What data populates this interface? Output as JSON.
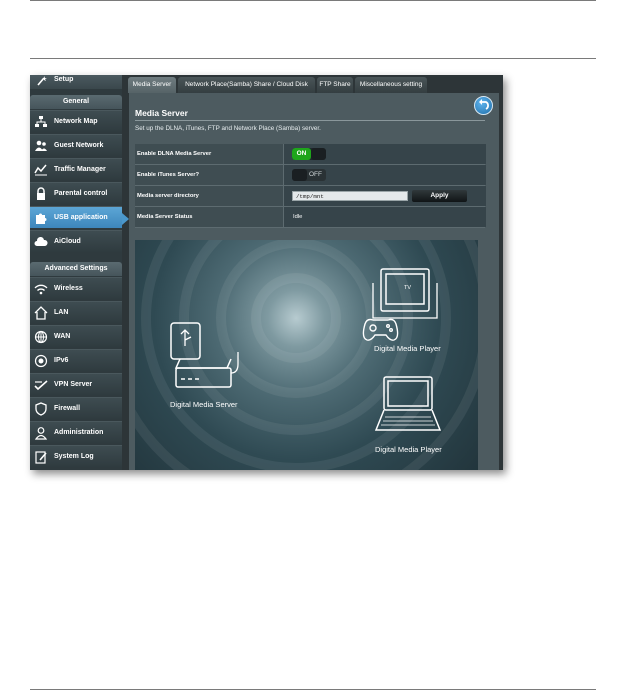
{
  "sidebar": {
    "setup_label": "Setup",
    "general_header": "General",
    "general_items": [
      {
        "label": "Network Map",
        "icon": "network-map-icon"
      },
      {
        "label": "Guest Network",
        "icon": "guest-network-icon"
      },
      {
        "label": "Traffic Manager",
        "icon": "traffic-manager-icon"
      },
      {
        "label": "Parental control",
        "icon": "lock-icon"
      },
      {
        "label": "USB application",
        "icon": "puzzle-icon",
        "active": true
      },
      {
        "label": "AiCloud",
        "icon": "cloud-icon"
      }
    ],
    "advanced_header": "Advanced Settings",
    "advanced_items": [
      {
        "label": "Wireless",
        "icon": "wifi-icon"
      },
      {
        "label": "LAN",
        "icon": "home-icon"
      },
      {
        "label": "WAN",
        "icon": "globe-icon"
      },
      {
        "label": "IPv6",
        "icon": "ipv6-icon"
      },
      {
        "label": "VPN Server",
        "icon": "vpn-icon"
      },
      {
        "label": "Firewall",
        "icon": "shield-icon"
      },
      {
        "label": "Administration",
        "icon": "admin-icon"
      },
      {
        "label": "System Log",
        "icon": "log-icon"
      }
    ]
  },
  "tabs": [
    {
      "label": "Media Server",
      "active": true
    },
    {
      "label": "Network Place(Samba) Share / Cloud Disk"
    },
    {
      "label": "FTP Share"
    },
    {
      "label": "Miscellaneous setting"
    }
  ],
  "main": {
    "title": "Media Server",
    "description": "Set up the DLNA, iTunes, FTP and Network Place (Samba) server.",
    "rows": {
      "dlna_label": "Enable DLNA Media Server",
      "dlna_state": "ON",
      "itunes_label": "Enable iTunes Server?",
      "itunes_state": "OFF",
      "dir_label": "Media server directory",
      "dir_value": "/tmp/mnt",
      "apply_label": "Apply",
      "status_label": "Media Server Status",
      "status_value": "Idle"
    }
  },
  "illustration": {
    "server_label": "Digital  Media Server",
    "player1_label": "Digital  Media Player",
    "player2_label": "Digital  Media Player",
    "tv_label": "TV"
  },
  "colors": {
    "accent": "#4a97cb",
    "toggle_on": "#1fa51b",
    "panel_bg": "#4d5b60"
  }
}
